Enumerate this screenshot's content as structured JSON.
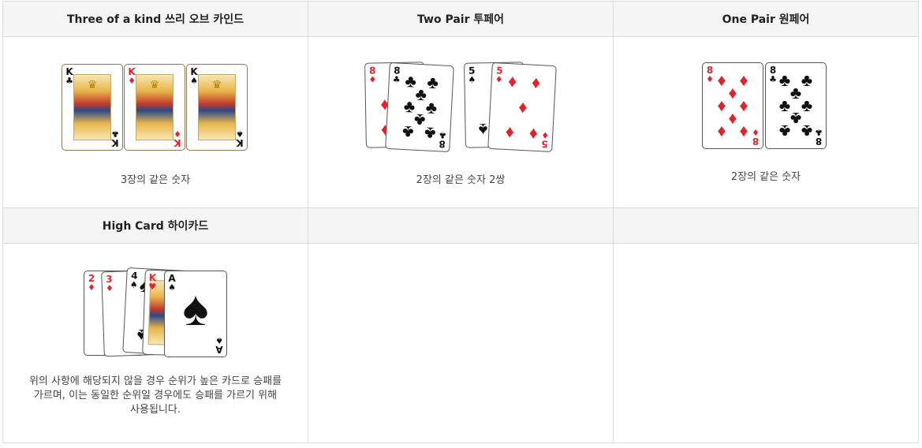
{
  "headers": {
    "three_kind": "Three of a kind 쓰리 오브 카인드",
    "two_pair": "Two Pair 투페어",
    "one_pair": "One Pair 원페어",
    "high_card": "High Card 하이카드"
  },
  "captions": {
    "three_kind": "3장의 같은 숫자",
    "two_pair": "2장의 같은 숫자 2쌍",
    "one_pair": "2장의 같은 숫자",
    "high_card_line1": "위의 사항에 해당되지 않을 경우 순위가 높은 카드로 승패를",
    "high_card_line2": "가르며, 이는 동일한 순위일 경우에도 승패를 가르기 위해",
    "high_card_line3": "사용됩니다."
  },
  "cards": {
    "three_kind": [
      {
        "rank": "K",
        "suit": "♣",
        "color": "black"
      },
      {
        "rank": "K",
        "suit": "♦",
        "color": "red"
      },
      {
        "rank": "K",
        "suit": "♠",
        "color": "black"
      }
    ],
    "two_pair": [
      {
        "rank": "8",
        "suit": "♦",
        "color": "red"
      },
      {
        "rank": "8",
        "suit": "♣",
        "color": "black"
      },
      {
        "rank": "5",
        "suit": "♠",
        "color": "black"
      },
      {
        "rank": "5",
        "suit": "♦",
        "color": "red"
      }
    ],
    "one_pair": [
      {
        "rank": "8",
        "suit": "♦",
        "color": "red"
      },
      {
        "rank": "8",
        "suit": "♣",
        "color": "black"
      }
    ],
    "high_card": [
      {
        "rank": "2",
        "suit": "♦",
        "color": "red"
      },
      {
        "rank": "3",
        "suit": "♦",
        "color": "red"
      },
      {
        "rank": "4",
        "suit": "♠",
        "color": "black"
      },
      {
        "rank": "K",
        "suit": "♥",
        "color": "red"
      },
      {
        "rank": "A",
        "suit": "♠",
        "color": "black"
      }
    ]
  },
  "colors": {
    "red": "#e0242f",
    "black": "#111111",
    "header_bg": "#f5f5f5",
    "border": "#dcdcdc"
  }
}
